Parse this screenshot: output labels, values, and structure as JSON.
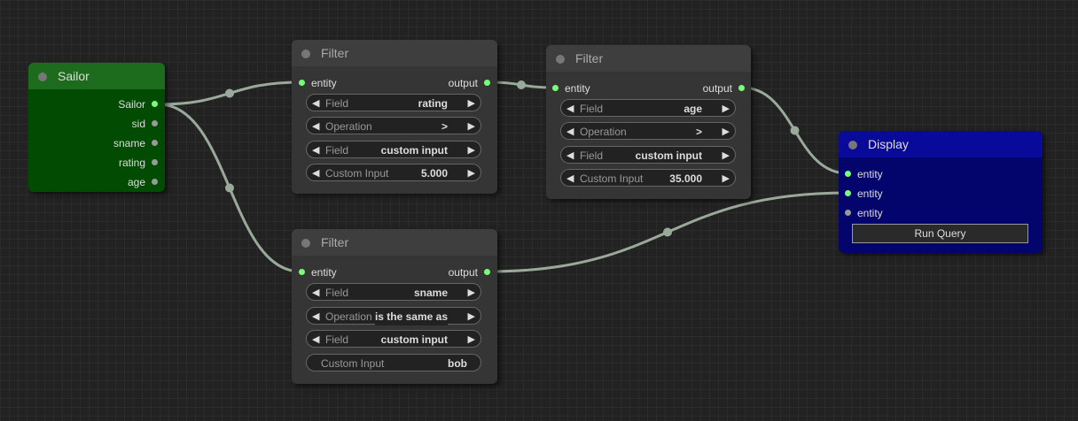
{
  "colors": {
    "link": "#9aaa9a",
    "port_connected": "#77ff77",
    "port_empty": "#999999",
    "sailor_title": "#1d6b1d",
    "sailor_body": "#024b02",
    "display_title": "#0a0a9a",
    "display_body": "#04046d"
  },
  "sailor_node": {
    "title": "Sailor",
    "outputs": [
      "Sailor",
      "sid",
      "sname",
      "rating",
      "age"
    ]
  },
  "filter_1": {
    "title": "Filter",
    "input": "entity",
    "output": "output",
    "widgets": [
      {
        "label": "Field",
        "value": "rating"
      },
      {
        "label": "Operation",
        "value": ">"
      },
      {
        "label": "Field",
        "value": "custom input"
      },
      {
        "label": "Custom Input",
        "value": "5.000"
      }
    ]
  },
  "filter_2": {
    "title": "Filter",
    "input": "entity",
    "output": "output",
    "widgets": [
      {
        "label": "Field",
        "value": "age"
      },
      {
        "label": "Operation",
        "value": ">"
      },
      {
        "label": "Field",
        "value": "custom input"
      },
      {
        "label": "Custom Input",
        "value": "35.000"
      }
    ]
  },
  "filter_3": {
    "title": "Filter",
    "input": "entity",
    "output": "output",
    "widgets": [
      {
        "label": "Field",
        "value": "sname"
      },
      {
        "label": "Operation",
        "value": "is the same as"
      },
      {
        "label": "Field",
        "value": "custom input"
      },
      {
        "label": "Custom Input",
        "value": "bob"
      }
    ]
  },
  "display_node": {
    "title": "Display",
    "inputs": [
      "entity",
      "entity",
      "entity"
    ],
    "button": "Run Query"
  },
  "icons": {
    "left_arrow": "◀",
    "right_arrow": "▶"
  }
}
